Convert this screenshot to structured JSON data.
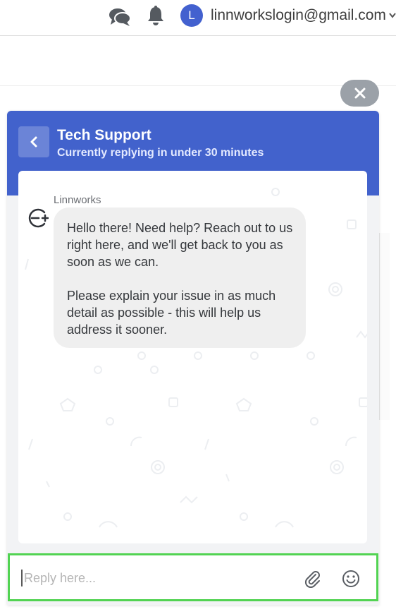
{
  "topbar": {
    "user_initial": "L",
    "user_email": "linnworkslogin@gmail.com",
    "icons": [
      "chat-bubbles-icon",
      "bell-icon",
      "chevron-down-icon"
    ]
  },
  "widget": {
    "header": {
      "title": "Tech Support",
      "subtitle": "Currently replying in under 30 minutes",
      "back_icon": "chevron-left-icon",
      "color": "#4262cc"
    },
    "close_icon": "close-icon",
    "messages": [
      {
        "sender": "Linnworks",
        "avatar_icon": "linnworks-logo-icon",
        "paragraphs": [
          "Hello there! Need help? Reach out to us right here, and we'll get back to you as soon as we can.",
          "Please explain your issue in as much detail as possible - this will help us address it sooner."
        ]
      }
    ],
    "reply": {
      "placeholder": "Reply here...",
      "value": "",
      "attach_icon": "paperclip-icon",
      "emoji_icon": "smiley-icon",
      "focus_color": "#52d352"
    }
  }
}
